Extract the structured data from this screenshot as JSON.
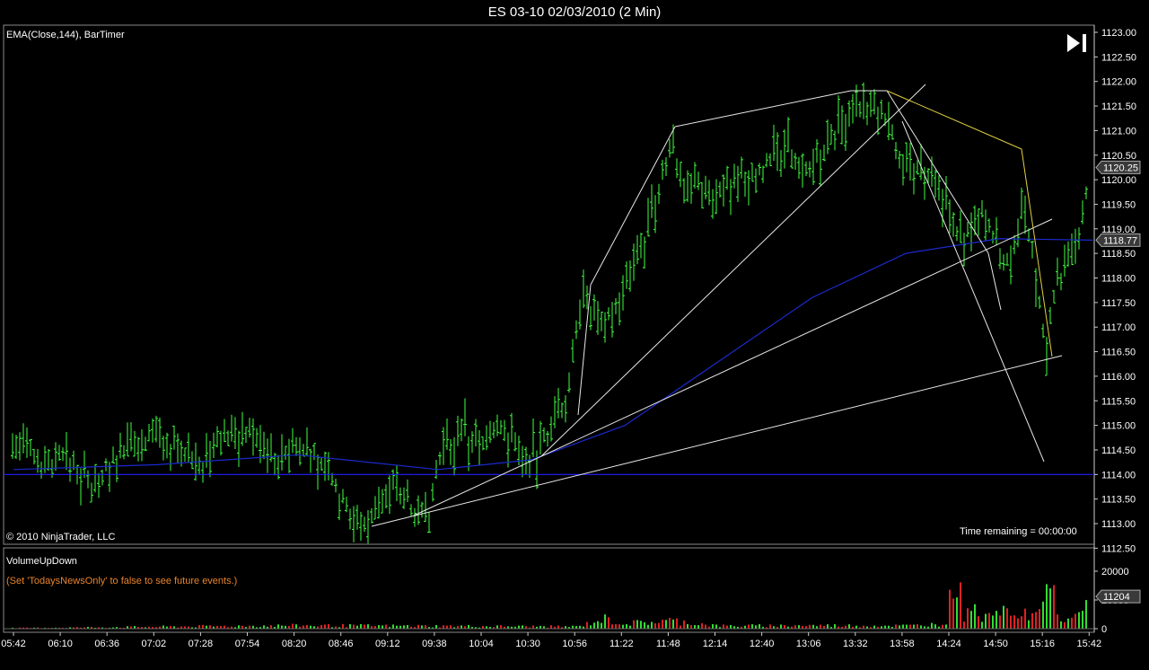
{
  "window": {
    "title": "ES 03-10  02/03/2010 (2 Min)"
  },
  "price_panel": {
    "indicators_label": "EMA(Close,144), BarTimer",
    "copyright": "© 2010 NinjaTrader, LLC",
    "time_remaining": "Time remaining = 00:00:00",
    "last_price_tag": "1120.25",
    "ema_price_tag": "1118.77"
  },
  "volume_panel": {
    "title": "VolumeUpDown",
    "note": "(Set 'TodaysNewsOnly' to false to see future events.)",
    "last_volume_tag": "11204"
  },
  "colors": {
    "bars": "#40ff40",
    "ema": "#1a2acc",
    "hline": "#2020ff",
    "trend": "#e8e8e8",
    "yellow": "#e0d040",
    "vol_up": "#33dd33",
    "vol_down": "#dd2222"
  },
  "chart_data": [
    {
      "type": "ohlc",
      "title": "ES 03-10  02/03/2010 (2 Min)",
      "bar_interval": "2 Min",
      "x_tick_labels": [
        "05:42",
        "06:10",
        "06:36",
        "07:02",
        "07:28",
        "07:54",
        "08:20",
        "08:46",
        "09:12",
        "09:38",
        "10:04",
        "10:30",
        "10:56",
        "11:22",
        "11:48",
        "12:14",
        "12:40",
        "13:06",
        "13:32",
        "13:58",
        "14:24",
        "14:50",
        "15:16",
        "15:42"
      ],
      "y_tick_labels": [
        "1112.50",
        "1113.00",
        "1113.50",
        "1114.00",
        "1114.50",
        "1115.00",
        "1115.50",
        "1116.00",
        "1116.50",
        "1117.00",
        "1117.50",
        "1118.00",
        "1118.50",
        "1119.00",
        "1119.50",
        "1120.00",
        "1120.50",
        "1121.00",
        "1121.50",
        "1122.00",
        "1122.50",
        "1123.00"
      ],
      "ylim": [
        1112.5,
        1123.0
      ],
      "price_path": [
        [
          "05:42",
          1114.6
        ],
        [
          "06:00",
          1114.2
        ],
        [
          "06:10",
          1114.4
        ],
        [
          "06:25",
          1113.8
        ],
        [
          "06:36",
          1114.2
        ],
        [
          "06:50",
          1114.6
        ],
        [
          "07:02",
          1114.9
        ],
        [
          "07:15",
          1114.4
        ],
        [
          "07:28",
          1114.2
        ],
        [
          "07:40",
          1114.8
        ],
        [
          "07:54",
          1114.9
        ],
        [
          "08:10",
          1114.3
        ],
        [
          "08:20",
          1114.6
        ],
        [
          "08:35",
          1114.1
        ],
        [
          "08:46",
          1113.4
        ],
        [
          "08:55",
          1112.9
        ],
        [
          "09:05",
          1113.3
        ],
        [
          "09:12",
          1113.9
        ],
        [
          "09:25",
          1113.3
        ],
        [
          "09:32",
          1113.0
        ],
        [
          "09:38",
          1114.3
        ],
        [
          "09:50",
          1114.8
        ],
        [
          "10:04",
          1114.7
        ],
        [
          "10:15",
          1114.9
        ],
        [
          "10:30",
          1114.3
        ],
        [
          "10:40",
          1114.9
        ],
        [
          "10:50",
          1115.4
        ],
        [
          "10:56",
          1117.5
        ],
        [
          "11:08",
          1117.3
        ],
        [
          "11:15",
          1117.2
        ],
        [
          "11:22",
          1117.8
        ],
        [
          "11:35",
          1119.0
        ],
        [
          "11:48",
          1120.7
        ],
        [
          "11:55",
          1120.0
        ],
        [
          "12:05",
          1119.9
        ],
        [
          "12:14",
          1119.7
        ],
        [
          "12:25",
          1120.0
        ],
        [
          "12:40",
          1120.3
        ],
        [
          "12:52",
          1120.6
        ],
        [
          "13:06",
          1120.2
        ],
        [
          "13:20",
          1121.0
        ],
        [
          "13:32",
          1121.4
        ],
        [
          "13:45",
          1121.3
        ],
        [
          "13:58",
          1120.3
        ],
        [
          "14:10",
          1120.0
        ],
        [
          "14:24",
          1119.2
        ],
        [
          "14:30",
          1118.7
        ],
        [
          "14:40",
          1119.5
        ],
        [
          "14:50",
          1118.6
        ],
        [
          "14:56",
          1118.2
        ],
        [
          "15:02",
          1119.3
        ],
        [
          "15:08",
          1118.6
        ],
        [
          "15:16",
          1116.6
        ],
        [
          "15:22",
          1117.9
        ],
        [
          "15:30",
          1118.5
        ],
        [
          "15:36",
          1119.2
        ],
        [
          "15:42",
          1120.25
        ]
      ],
      "ema_144": [
        [
          "05:42",
          1114.1
        ],
        [
          "07:02",
          1114.2
        ],
        [
          "08:20",
          1114.4
        ],
        [
          "09:38",
          1114.1
        ],
        [
          "10:30",
          1114.3
        ],
        [
          "11:22",
          1115.0
        ],
        [
          "12:14",
          1116.3
        ],
        [
          "13:06",
          1117.6
        ],
        [
          "13:58",
          1118.5
        ],
        [
          "14:50",
          1118.8
        ],
        [
          "15:42",
          1118.77
        ]
      ],
      "horizontal_line": 1114.0,
      "last_price": 1120.25,
      "ema_value": 1118.77
    },
    {
      "type": "bar",
      "title": "VolumeUpDown",
      "y_tick_labels": [
        "0",
        "10000",
        "20000"
      ],
      "ylim": [
        0,
        25000
      ],
      "volume_profile": [
        [
          "05:42",
          300
        ],
        [
          "08:20",
          1400
        ],
        [
          "10:56",
          900
        ],
        [
          "11:10",
          4300
        ],
        [
          "11:22",
          2200
        ],
        [
          "11:48",
          3500
        ],
        [
          "12:14",
          1200
        ],
        [
          "13:06",
          1400
        ],
        [
          "14:00",
          1300
        ],
        [
          "14:20",
          2200
        ],
        [
          "14:26",
          24000
        ],
        [
          "14:30",
          7000
        ],
        [
          "14:50",
          6500
        ],
        [
          "15:10",
          6000
        ],
        [
          "15:14",
          7000
        ],
        [
          "15:18",
          22000
        ],
        [
          "15:24",
          5000
        ],
        [
          "15:32",
          4800
        ],
        [
          "15:42",
          11204
        ]
      ],
      "last_volume": 11204
    }
  ]
}
